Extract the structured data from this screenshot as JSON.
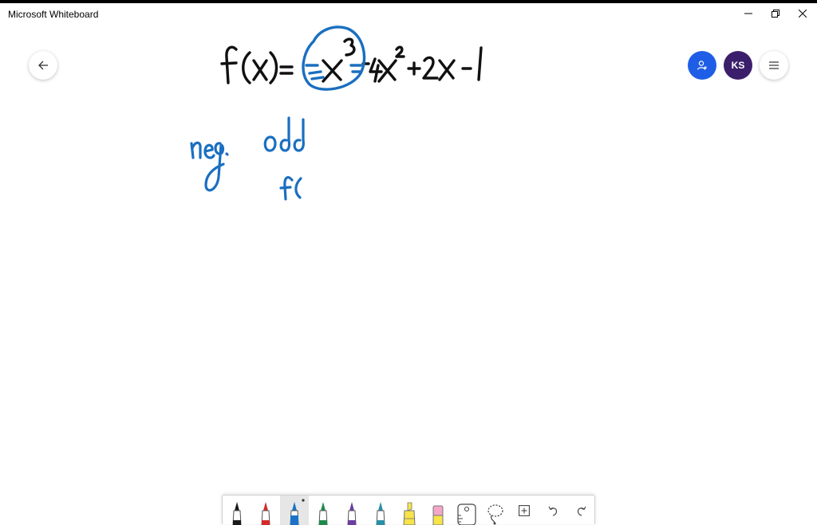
{
  "window": {
    "title": "Microsoft Whiteboard",
    "minimize_icon": "minimize-icon",
    "restore_icon": "restore-icon",
    "close_icon": "close-icon"
  },
  "header": {
    "back_icon": "arrow-left-icon",
    "share_icon": "add-person-icon",
    "avatar_initials": "KS",
    "menu_icon": "hamburger-menu-icon"
  },
  "ink": {
    "equation": "f(x)=-x³-4x²+2x-1",
    "notes": [
      "neg.",
      "odd",
      "f("
    ]
  },
  "toolbar": {
    "tools": [
      {
        "name": "pen-black",
        "color": "#1a1a1a"
      },
      {
        "name": "pen-red",
        "color": "#d42a2a"
      },
      {
        "name": "pen-blue",
        "color": "#1a73c8",
        "selected": true
      },
      {
        "name": "pen-green",
        "color": "#1f8a4c"
      },
      {
        "name": "pen-purple",
        "color": "#6a3ea1"
      },
      {
        "name": "pen-teal",
        "color": "#2a8fa6"
      },
      {
        "name": "highlighter-yellow",
        "color": "#f7e34a"
      },
      {
        "name": "eraser",
        "color": "#f4a6c8"
      },
      {
        "name": "ruler",
        "color": "#444444"
      },
      {
        "name": "lasso",
        "color": "#444444"
      },
      {
        "name": "add",
        "color": "#444444"
      },
      {
        "name": "undo",
        "color": "#444444"
      },
      {
        "name": "redo",
        "color": "#444444"
      }
    ]
  },
  "colors": {
    "accent_blue": "#1e5ee6",
    "avatar_bg": "#3b1f6b",
    "ink_black": "#111111",
    "ink_blue": "#1a6fc0"
  }
}
